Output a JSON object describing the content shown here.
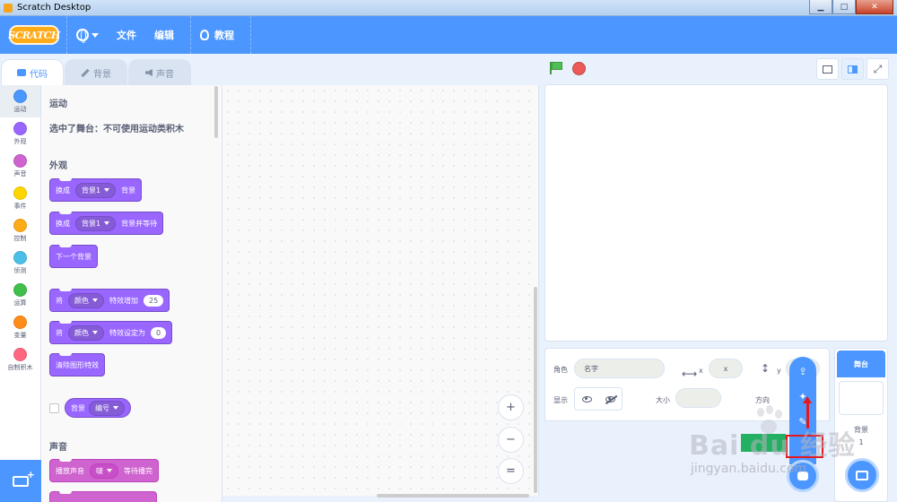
{
  "window": {
    "title": "Scratch Desktop",
    "min": "▁",
    "max": "□",
    "close": "✕"
  },
  "menubar": {
    "logo": "SCRATCH",
    "file": "文件",
    "edit": "编辑",
    "tutorials": "教程"
  },
  "tabs": {
    "code": "代码",
    "backdrops": "背景",
    "sounds": "声音"
  },
  "categories": [
    {
      "label": "运动",
      "color": "#4c97ff"
    },
    {
      "label": "外观",
      "color": "#9966ff"
    },
    {
      "label": "声音",
      "color": "#cf63cf"
    },
    {
      "label": "事件",
      "color": "#ffd500"
    },
    {
      "label": "控制",
      "color": "#ffab19"
    },
    {
      "label": "侦测",
      "color": "#4cbfe6"
    },
    {
      "label": "运算",
      "color": "#40bf4a"
    },
    {
      "label": "变量",
      "color": "#ff8c1a"
    },
    {
      "label": "自制积木",
      "color": "#ff6680"
    }
  ],
  "palette": {
    "motion_heading": "运动",
    "motion_note": "选中了舞台：不可使用运动类积木",
    "looks_heading": "外观",
    "switch_backdrop": {
      "pre": "换成",
      "dd": "背景1",
      "post": "背景"
    },
    "switch_backdrop_wait": {
      "pre": "换成",
      "dd": "背景1",
      "post": "背景并等待"
    },
    "next_backdrop": "下一个背景",
    "change_effect": {
      "pre": "将",
      "dd": "颜色",
      "post": "特效增加",
      "value": "25"
    },
    "set_effect": {
      "pre": "将",
      "dd": "颜色",
      "post": "特效设定为",
      "value": "0"
    },
    "clear_effects": "清除图形特效",
    "backdrop_reporter": {
      "pre": "背景",
      "dd": "编号"
    },
    "sound_heading": "声音",
    "play_sound": {
      "pre": "播放声音",
      "dd": "啵",
      "post": "等待播完"
    }
  },
  "zoom": {
    "in": "+",
    "out": "−",
    "reset": "="
  },
  "sprite_info": {
    "sprite_label": "角色",
    "name_placeholder": "名字",
    "x_label": "x",
    "x_value": "x",
    "y_label": "y",
    "y_value": "y",
    "show_label": "显示",
    "size_label": "大小",
    "direction_label": "方向"
  },
  "stage_target": {
    "header": "舞台",
    "backdrops_label": "背景",
    "backdrops_count": "1"
  },
  "chooser": {
    "upload": "⇪",
    "surprise": "✦",
    "paint": "✎"
  },
  "watermark": {
    "brand": "Bai du 经验",
    "url": "jingyan.baidu.com"
  },
  "colors": {
    "menubar": "#4c97ff",
    "looks": "#9966ff",
    "sound": "#cf63cf",
    "flag": "#4cbf56",
    "stop": "#ec5959"
  }
}
